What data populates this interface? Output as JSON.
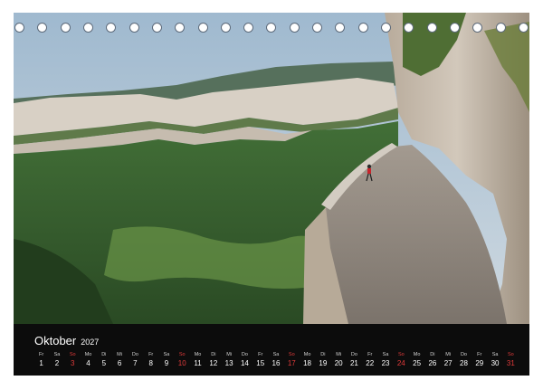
{
  "calendar": {
    "month": "Oktober",
    "year": "2027",
    "sunday_color": "#e23b3b",
    "days": [
      {
        "wd": "Fr",
        "d": "1",
        "sun": false
      },
      {
        "wd": "Sa",
        "d": "2",
        "sun": false
      },
      {
        "wd": "So",
        "d": "3",
        "sun": true
      },
      {
        "wd": "Mo",
        "d": "4",
        "sun": false
      },
      {
        "wd": "Di",
        "d": "5",
        "sun": false
      },
      {
        "wd": "Mi",
        "d": "6",
        "sun": false
      },
      {
        "wd": "Do",
        "d": "7",
        "sun": false
      },
      {
        "wd": "Fr",
        "d": "8",
        "sun": false
      },
      {
        "wd": "Sa",
        "d": "9",
        "sun": false
      },
      {
        "wd": "So",
        "d": "10",
        "sun": true
      },
      {
        "wd": "Mo",
        "d": "11",
        "sun": false
      },
      {
        "wd": "Di",
        "d": "12",
        "sun": false
      },
      {
        "wd": "Mi",
        "d": "13",
        "sun": false
      },
      {
        "wd": "Do",
        "d": "14",
        "sun": false
      },
      {
        "wd": "Fr",
        "d": "15",
        "sun": false
      },
      {
        "wd": "Sa",
        "d": "16",
        "sun": false
      },
      {
        "wd": "So",
        "d": "17",
        "sun": true
      },
      {
        "wd": "Mo",
        "d": "18",
        "sun": false
      },
      {
        "wd": "Di",
        "d": "19",
        "sun": false
      },
      {
        "wd": "Mi",
        "d": "20",
        "sun": false
      },
      {
        "wd": "Do",
        "d": "21",
        "sun": false
      },
      {
        "wd": "Fr",
        "d": "22",
        "sun": false
      },
      {
        "wd": "Sa",
        "d": "23",
        "sun": false
      },
      {
        "wd": "So",
        "d": "24",
        "sun": true
      },
      {
        "wd": "Mo",
        "d": "25",
        "sun": false
      },
      {
        "wd": "Di",
        "d": "26",
        "sun": false
      },
      {
        "wd": "Mi",
        "d": "27",
        "sun": false
      },
      {
        "wd": "Do",
        "d": "28",
        "sun": false
      },
      {
        "wd": "Fr",
        "d": "29",
        "sun": false
      },
      {
        "wd": "Sa",
        "d": "30",
        "sun": false
      },
      {
        "wd": "So",
        "d": "31",
        "sun": true
      }
    ]
  },
  "photo": {
    "subject": "cliff-road-above-green-valley",
    "palette": {
      "sky": "#aec4d6",
      "rock": "#c9bfb2",
      "forest": "#3f6b33",
      "road": "#8d857d"
    }
  },
  "binding": {
    "ring_count": 23,
    "ring_icon": "spiral-ring-icon"
  }
}
